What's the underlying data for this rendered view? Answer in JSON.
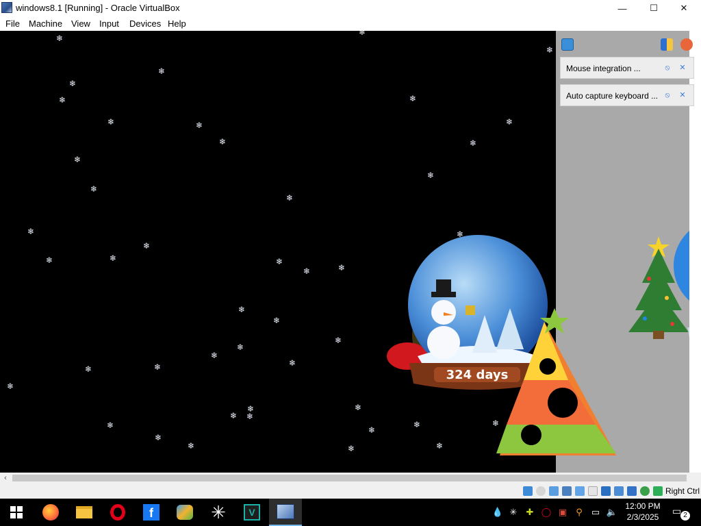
{
  "window": {
    "title": "windows8.1 [Running] - Oracle VirtualBox"
  },
  "window_controls": {
    "minimize": "—",
    "maximize": "☐",
    "close": "✕"
  },
  "menu": [
    "File",
    "Machine",
    "View",
    "Input",
    "Devices",
    "Help"
  ],
  "guest": {
    "countdown_text": "324 days",
    "notifications": [
      {
        "text": "Mouse integration ..."
      },
      {
        "text": "Auto capture keyboard ..."
      }
    ]
  },
  "statusbar": {
    "host_key": "Right Ctrl"
  },
  "taskbar": {
    "apps": [
      {
        "name": "firefox-icon"
      },
      {
        "name": "file-explorer-icon"
      },
      {
        "name": "opera-icon"
      },
      {
        "name": "facebook-icon"
      },
      {
        "name": "windows-live-icon"
      },
      {
        "name": "snowflake-app-icon"
      },
      {
        "name": "visual-studio-icon"
      },
      {
        "name": "virtualbox-icon",
        "active": true
      }
    ],
    "clock": {
      "time": "12:00 PM",
      "date": "2/3/2025"
    },
    "notification_count": "2"
  },
  "colors": {
    "desktop": "#000000",
    "sidebar": "#a9a9a9",
    "taskbar": "#000000",
    "accent": "#76b9ed"
  }
}
